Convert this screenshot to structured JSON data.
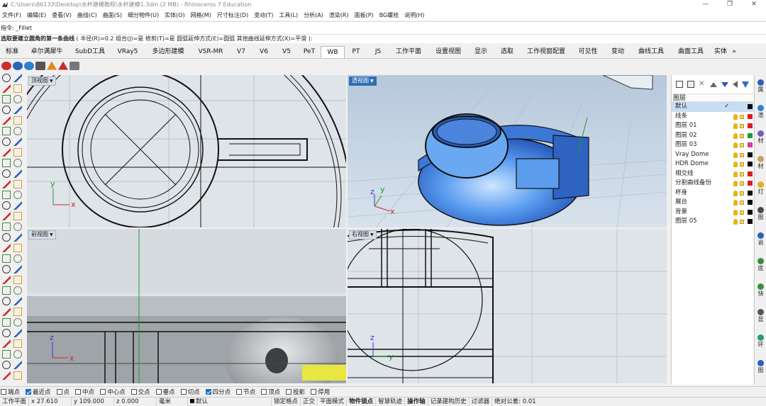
{
  "window": {
    "title": "C:\\Users\\86133\\Desktop\\水杯建模教程\\水杯建模1.3dm (2 MB) - Rhinoceros 7 Education",
    "minimize": "—",
    "restore": "❐",
    "close": "✕"
  },
  "menu": [
    "文件(F)",
    "编辑(E)",
    "查看(V)",
    "曲线(C)",
    "曲面(S)",
    "细分物件(U)",
    "实体(O)",
    "网格(M)",
    "尺寸标注(D)",
    "变动(T)",
    "工具(L)",
    "分析(A)",
    "渲染(R)",
    "面板(P)",
    "BG螺栓",
    "说明(H)"
  ],
  "command": {
    "history": "指令: _Fillet",
    "prompt_bold": "选取要建立圆角的第一条曲线",
    "prompt_options": " ( 半径(R)=0.2  组合(J)=是  修剪(T)=是  圆弧延伸方式(E)=圆弧  其他曲线延伸方式(X)=平滑 ):"
  },
  "tabs": [
    "标准",
    "卓尔满犀牛",
    "SubD工具",
    "VRay5",
    "多边形建模",
    "VSR-MR",
    "V7",
    "V6",
    "V5",
    "PeT",
    "WB",
    "PT",
    "JS",
    "工作平面",
    "设置视图",
    "显示",
    "选取",
    "工作视窗配置",
    "可见性",
    "变动",
    "曲线工具",
    "曲面工具",
    "实体"
  ],
  "active_tab": "WB",
  "tabs_more": "»",
  "viewports": {
    "top": "顶视图",
    "perspective": "透视图",
    "front": "前视图",
    "right": "右视图",
    "axis_x": "x",
    "axis_y": "y",
    "axis_z": "z"
  },
  "layers": {
    "header": "图层",
    "items": [
      {
        "name": "默认",
        "color": "#000000",
        "current": true
      },
      {
        "name": "线条",
        "color": "#d62020"
      },
      {
        "name": "图层 01",
        "color": "#d62020"
      },
      {
        "name": "图层 02",
        "color": "#1f9a3a"
      },
      {
        "name": "图层 03",
        "color": "#d6389e"
      },
      {
        "name": "Vray Dome",
        "color": "#000000"
      },
      {
        "name": "HDR Dome",
        "color": "#000000"
      },
      {
        "name": "相交线",
        "color": "#d62020"
      },
      {
        "name": "分割曲线备份",
        "color": "#d62020"
      },
      {
        "name": "杯身",
        "color": "#000000"
      },
      {
        "name": "展台",
        "color": "#000000"
      },
      {
        "name": "背景",
        "color": "#000000"
      },
      {
        "name": "图层 05",
        "color": "#000000"
      }
    ]
  },
  "right_rail": [
    "属",
    "渲",
    "材",
    "材",
    "灯",
    "图",
    "说",
    "底",
    "快",
    "显",
    "环",
    "图"
  ],
  "osnaps": [
    {
      "label": "端点",
      "on": false
    },
    {
      "label": "最近点",
      "on": true
    },
    {
      "label": "点",
      "on": false
    },
    {
      "label": "中点",
      "on": false
    },
    {
      "label": "中心点",
      "on": false
    },
    {
      "label": "交点",
      "on": false
    },
    {
      "label": "垂点",
      "on": false
    },
    {
      "label": "切点",
      "on": false
    },
    {
      "label": "四分点",
      "on": true
    },
    {
      "label": "节点",
      "on": false
    },
    {
      "label": "顶点",
      "on": false
    },
    {
      "label": "投影",
      "on": false
    },
    {
      "label": "停用",
      "on": false
    }
  ],
  "status": {
    "cplane": "工作平面",
    "x": "x 27.610",
    "y": "y 109.000",
    "z": "z 0.000",
    "units": "毫米",
    "layer": "默认",
    "grid_snap": "锁定格点",
    "ortho": "正交",
    "planar": "平面模式",
    "osnap": "物件锁点",
    "smarttrack": "智慧轨迹",
    "gumball": "操作轴",
    "history": "记录建构历史",
    "filter": "过滤器",
    "absolute_tolerance": "绝对公差: 0.01"
  }
}
